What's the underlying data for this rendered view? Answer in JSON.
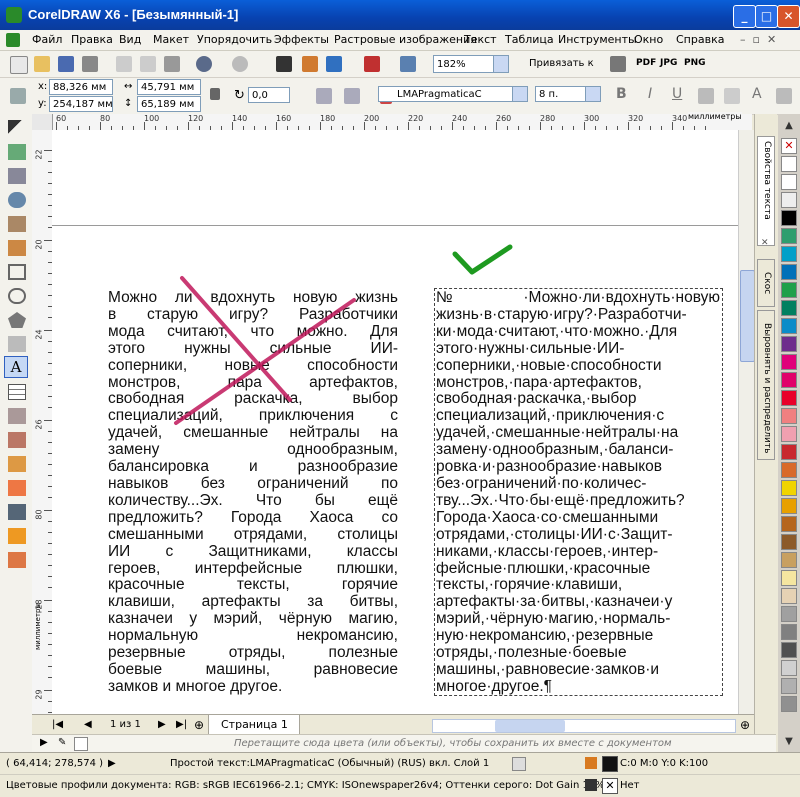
{
  "window": {
    "title": "CorelDRAW X6 - [Безымянный-1]"
  },
  "menu": [
    "Файл",
    "Правка",
    "Вид",
    "Макет",
    "Упорядочить",
    "Эффекты",
    "Растровые изображения",
    "Текст",
    "Таблица",
    "Инструменты",
    "Окно",
    "Справка"
  ],
  "toolbar1": {
    "zoom": "182%",
    "snap_label": "Привязать к",
    "pdf": "PDF",
    "jpg": "JPG",
    "png": "PNG"
  },
  "toolbar2": {
    "x_label": "x:",
    "x_value": "88,326 мм",
    "y_label": "y:",
    "y_value": "254,187 мм",
    "w_value": "45,791 мм",
    "h_value": "65,189 мм",
    "angle_value": "0,0",
    "font_name": "LMAPragmaticaC",
    "font_size": "8 п."
  },
  "ruler": {
    "units": "миллиметры",
    "h_ticks": [
      "60",
      "80",
      "100",
      "120",
      "140",
      "160",
      "180",
      "200",
      "220",
      "240",
      "260",
      "280",
      "300",
      "320",
      "340"
    ],
    "v_ticks": [
      "22",
      "20",
      "24",
      "26",
      "80",
      "28",
      "29"
    ]
  },
  "canvas": {
    "left_paragraph": [
      "Можно ли вдохнуть новую жизнь",
      "в старую игру? Разработчики",
      "мода считают, что можно. Для",
      "этого нужны сильные ИИ-",
      "соперники, новые способности",
      "монстров, пара артефактов,",
      "свободная раскачка, выбор",
      "специализаций, приключения с",
      "удачей, смешанные нейтралы на",
      "замену однообразным,",
      "балансировка и разнообразие",
      "навыков без ограничений по",
      "количеству...Эх. Что бы ещё",
      "предложить? Города Хаоса со",
      "смешанными отрядами, столицы",
      "ИИ с Защитниками, классы",
      "героев, интерфейсные плюшки,",
      "красочные тексты, горячие",
      "клавиши, артефакты за битвы,",
      "казначеи у мэрий, чёрную магию,",
      "нормальную некромансию,",
      "резервные отряды, полезные",
      "боевые машины, равновесие",
      "замков и многое другое."
    ],
    "right_paragraph": [
      "№·Можно·ли·вдохнуть·новую",
      "жизнь·в·старую·игру?·Разработчи-",
      "ки·мода·считают,·что·можно.·Для",
      "этого·нужны·сильные·ИИ-",
      "соперники,·новые·способности",
      "монстров,·пара·артефактов,",
      "свободная·раскачка,·выбор",
      "специализаций,·приключения·с",
      "удачей,·смешанные·нейтралы·на",
      "замену·однообразным,·баланси-",
      "ровка·и·разнообразие·навыков",
      "без·ограничений·по·количес-",
      "тву...Эх.·Что·бы·ещё·предложить?",
      "Города·Хаоса·со·смешанными",
      "отрядами,·столицы·ИИ·с·Защит-",
      "никами,·классы·героев,·интер-",
      "фейсные·плюшки,·красочные",
      "тексты,·горячие·клавиши,",
      "артефакты·за·битвы,·казначеи·у",
      "мэрий,·чёрную·магию,·нормаль-",
      "ную·некромансию,·резервные",
      "отряды,·полезные·боевые",
      "машины,·равновесие·замков·и",
      "многое·другое.¶"
    ]
  },
  "docker": {
    "tab1": "Свойства текста",
    "tab2": "Скос",
    "tab3": "Выровнять и распределить"
  },
  "palette": [
    "#ffffff",
    "#ffffff",
    "#eeeeee",
    "#000000",
    "#2e9e6e",
    "#00a0c8",
    "#0070b8",
    "#1fa04a",
    "#008060",
    "#0a8cc8",
    "#6e2d8c",
    "#e0007a",
    "#e0006a",
    "#e8002a",
    "#f08080",
    "#f0a0b0",
    "#c8282e",
    "#d86a2a",
    "#f0d400",
    "#e8a000",
    "#b5651d",
    "#8c5a2a",
    "#c8a060",
    "#f5e6a0",
    "#e6d2b4",
    "#a0a0a0",
    "#808080",
    "#505050",
    "#d0d0d0",
    "#b0b0b0",
    "#909090"
  ],
  "pagebar": {
    "page_count": "1 из 1",
    "tab": "Страница 1"
  },
  "hint": "Перетащите сюда цвета (или объекты), чтобы сохранить их вместе с документом",
  "status": {
    "coords": "( 64,414; 278,574 )",
    "object_info": "Простой текст:LMAPragmaticaC (Обычный) (RUS) вкл. Слой 1",
    "fill_info": "C:0 M:0 Y:0 K:100",
    "outline_info": "Нет",
    "profiles": "Цветовые профили документа: RGB: sRGB IEC61966-2.1; CMYK: ISOnewspaper26v4; Оттенки серого: Dot Gain 15%"
  },
  "colors": {
    "cross": "#c0185a",
    "check": "#1e9a20",
    "titlebar": "#0a50c8"
  }
}
